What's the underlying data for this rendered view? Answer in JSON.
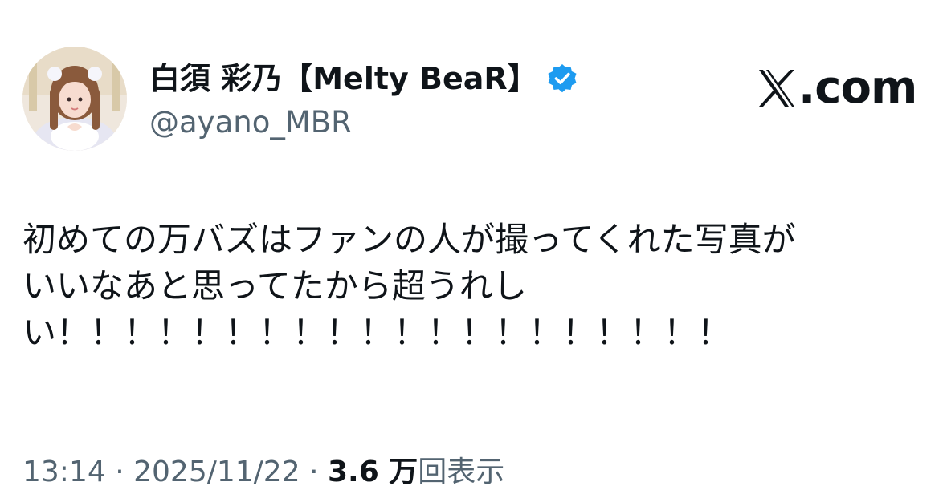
{
  "author": {
    "display_name": "白須 彩乃【Melty BeaR】",
    "handle": "@ayano_MBR",
    "verified": true,
    "verified_color": "#1d9bf0"
  },
  "brand": {
    "icon": "x-logo-icon",
    "suffix": ".com"
  },
  "tweet": {
    "lines": [
      "初めての万バズはファンの人が撮ってくれた写真が",
      "いいなあと思ってたから超うれし",
      "い！！！！！！！！！！！！！！！！！！！！"
    ]
  },
  "meta": {
    "time": "13:14",
    "separator": "·",
    "date": "2025/11/22",
    "views_count": "3.6 万",
    "views_label": "回表示"
  }
}
